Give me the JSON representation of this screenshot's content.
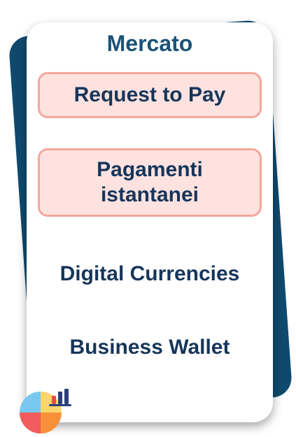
{
  "header": {
    "title": "Mercato"
  },
  "highlighted_items": [
    {
      "label": "Request to Pay"
    },
    {
      "label": "Pagamenti istantanei"
    }
  ],
  "plain_items": [
    {
      "label": "Digital Currencies"
    },
    {
      "label": "Business Wallet"
    }
  ],
  "icons": {
    "corner_icon": "pie-bar-chart-icon"
  },
  "colors": {
    "navy_back_card": "#0f4a6e",
    "title_text": "#1b5278",
    "item_text": "#16355a",
    "pill_fill": "#fde2df",
    "pill_border": "#f4a79c",
    "pie_blue": "#78c8f0",
    "pie_yellow": "#f8d66b",
    "pie_red": "#f25c5c",
    "pie_orange": "#f8903a",
    "bar_navy": "#2b3f7a",
    "bar_red": "#e94b4b"
  }
}
